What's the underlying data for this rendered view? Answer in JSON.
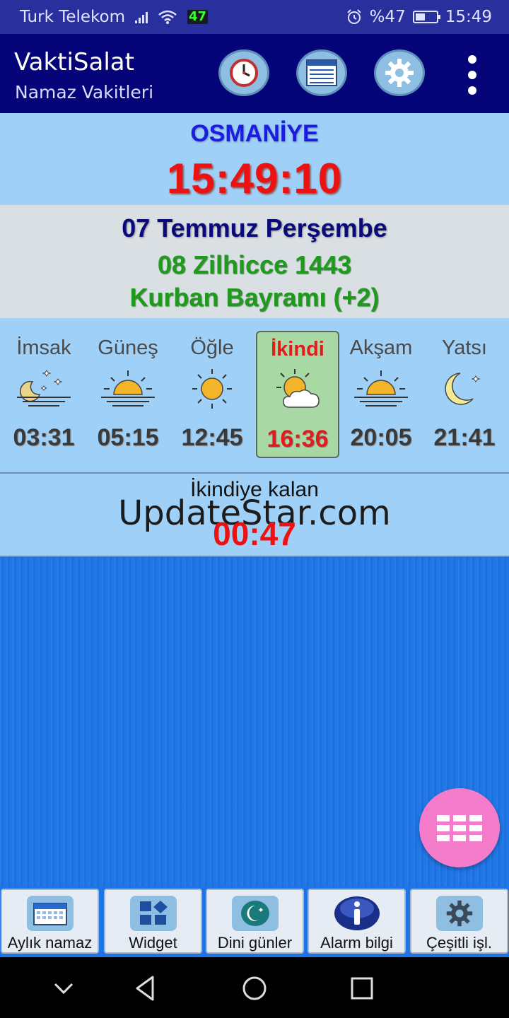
{
  "status": {
    "carrier": "Turk Telekom",
    "network_badge": "47",
    "battery": "%47",
    "battery_level": 0.47,
    "time": "15:49"
  },
  "app": {
    "title": "VaktiSalat",
    "subtitle": "Namaz Vakitleri"
  },
  "city": "OSMANİYE",
  "clock": "15:49:10",
  "dates": {
    "gregorian": "07 Temmuz Perşembe",
    "hijri": "08 Zilhicce 1443",
    "holiday": "Kurban Bayramı (+2)"
  },
  "prayers": [
    {
      "name": "İmsak",
      "time": "03:31",
      "icon": "moon-stars-horizon-icon"
    },
    {
      "name": "Güneş",
      "time": "05:15",
      "icon": "sunrise-icon"
    },
    {
      "name": "Öğle",
      "time": "12:45",
      "icon": "sun-icon"
    },
    {
      "name": "İkindi",
      "time": "16:36",
      "icon": "sun-cloud-icon",
      "active": true
    },
    {
      "name": "Akşam",
      "time": "20:05",
      "icon": "sunset-icon"
    },
    {
      "name": "Yatsı",
      "time": "21:41",
      "icon": "crescent-moon-icon"
    }
  ],
  "remaining": {
    "label": "İkindiye kalan",
    "time": "00:47"
  },
  "watermark": "UpdateStar.com",
  "bottom_buttons": [
    {
      "label": "Aylık namaz",
      "icon": "calendar-icon"
    },
    {
      "label": "Widget",
      "icon": "widget-icon"
    },
    {
      "label": "Dini günler",
      "icon": "crescent-icon"
    },
    {
      "label": "Alarm bilgi",
      "icon": "info-icon"
    },
    {
      "label": "Çeşitli işl.",
      "icon": "gear-icon"
    }
  ],
  "colors": {
    "appbar": "#050579",
    "statusbar": "#2a2f9e",
    "info_band": "#9fd0f8",
    "active_prayer": "#a8d9a5",
    "accent_red": "#ee1111",
    "fab": "#f57ccb"
  }
}
